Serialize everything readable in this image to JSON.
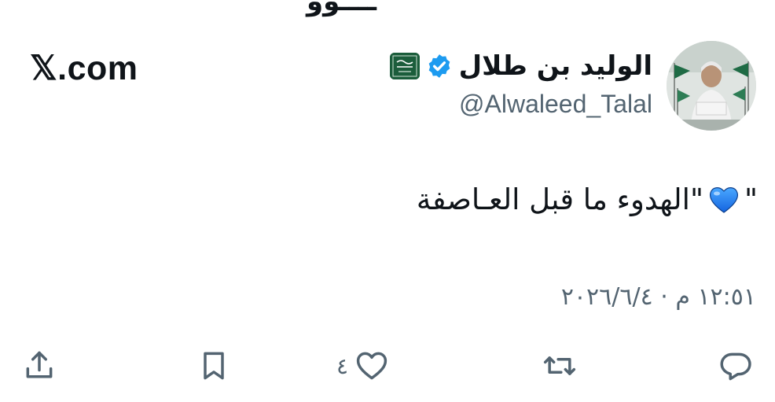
{
  "top_fragment": "ــــوو",
  "brand": "𝕏.com",
  "tweet": {
    "display_name": "الوليد بن طلال",
    "handle": "@Alwaleed_Talal",
    "text": "\"الهدوء ما قبل العـاصفة",
    "text_close": "\"",
    "timestamp": "١٢:٥١ م · ٢٠٢٦/٦/٤"
  },
  "actions": {
    "like_count": "٤"
  },
  "colors": {
    "verified": "#1d9bf0",
    "muted_text": "#536471",
    "primary_text": "#0f1419",
    "heart": "#1d7ff0",
    "flag": "#1b5d3b"
  },
  "icons": [
    "reply-icon",
    "retweet-icon",
    "like-icon",
    "bookmark-icon",
    "share-icon",
    "verified-icon",
    "blue-heart-emoji"
  ]
}
